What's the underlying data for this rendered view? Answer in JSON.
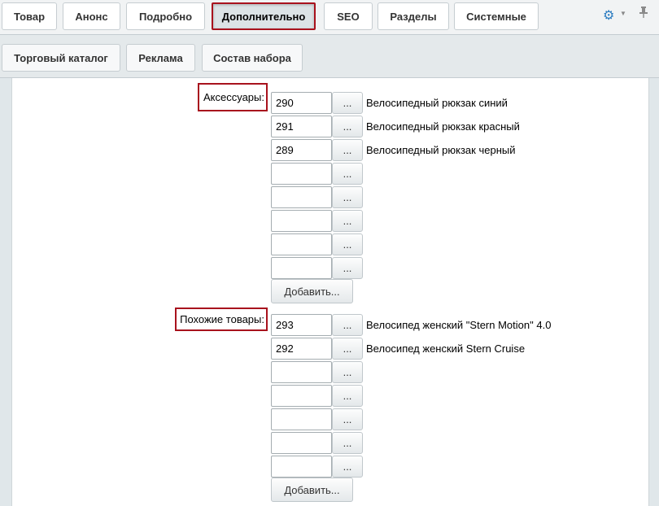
{
  "tabs_main": [
    {
      "label": "Товар"
    },
    {
      "label": "Анонс"
    },
    {
      "label": "Подробно"
    },
    {
      "label": "Дополнительно",
      "active": true
    },
    {
      "label": "SEO"
    },
    {
      "label": "Разделы"
    },
    {
      "label": "Системные"
    }
  ],
  "tabs_sub": [
    {
      "label": "Торговый каталог"
    },
    {
      "label": "Реклама"
    },
    {
      "label": "Состав набора"
    }
  ],
  "toolbar": {
    "settings_icon": "gear-icon",
    "pin_icon": "pin-icon"
  },
  "accessories": {
    "label": "Аксессуары:",
    "rows": [
      {
        "value": "290",
        "name": "Велосипедный рюкзак синий"
      },
      {
        "value": "291",
        "name": "Велосипедный рюкзак красный"
      },
      {
        "value": "289",
        "name": "Велосипедный рюкзак черный"
      },
      {
        "value": "",
        "name": ""
      },
      {
        "value": "",
        "name": ""
      },
      {
        "value": "",
        "name": ""
      },
      {
        "value": "",
        "name": ""
      },
      {
        "value": "",
        "name": ""
      }
    ],
    "browse_label": "...",
    "add_label": "Добавить..."
  },
  "similar": {
    "label": "Похожие товары:",
    "rows": [
      {
        "value": "293",
        "name": "Велосипед женский \"Stern Motion\" 4.0"
      },
      {
        "value": "292",
        "name": "Велосипед женский Stern Cruise"
      },
      {
        "value": "",
        "name": ""
      },
      {
        "value": "",
        "name": ""
      },
      {
        "value": "",
        "name": ""
      },
      {
        "value": "",
        "name": ""
      },
      {
        "value": "",
        "name": ""
      }
    ],
    "browse_label": "...",
    "add_label": "Добавить..."
  }
}
